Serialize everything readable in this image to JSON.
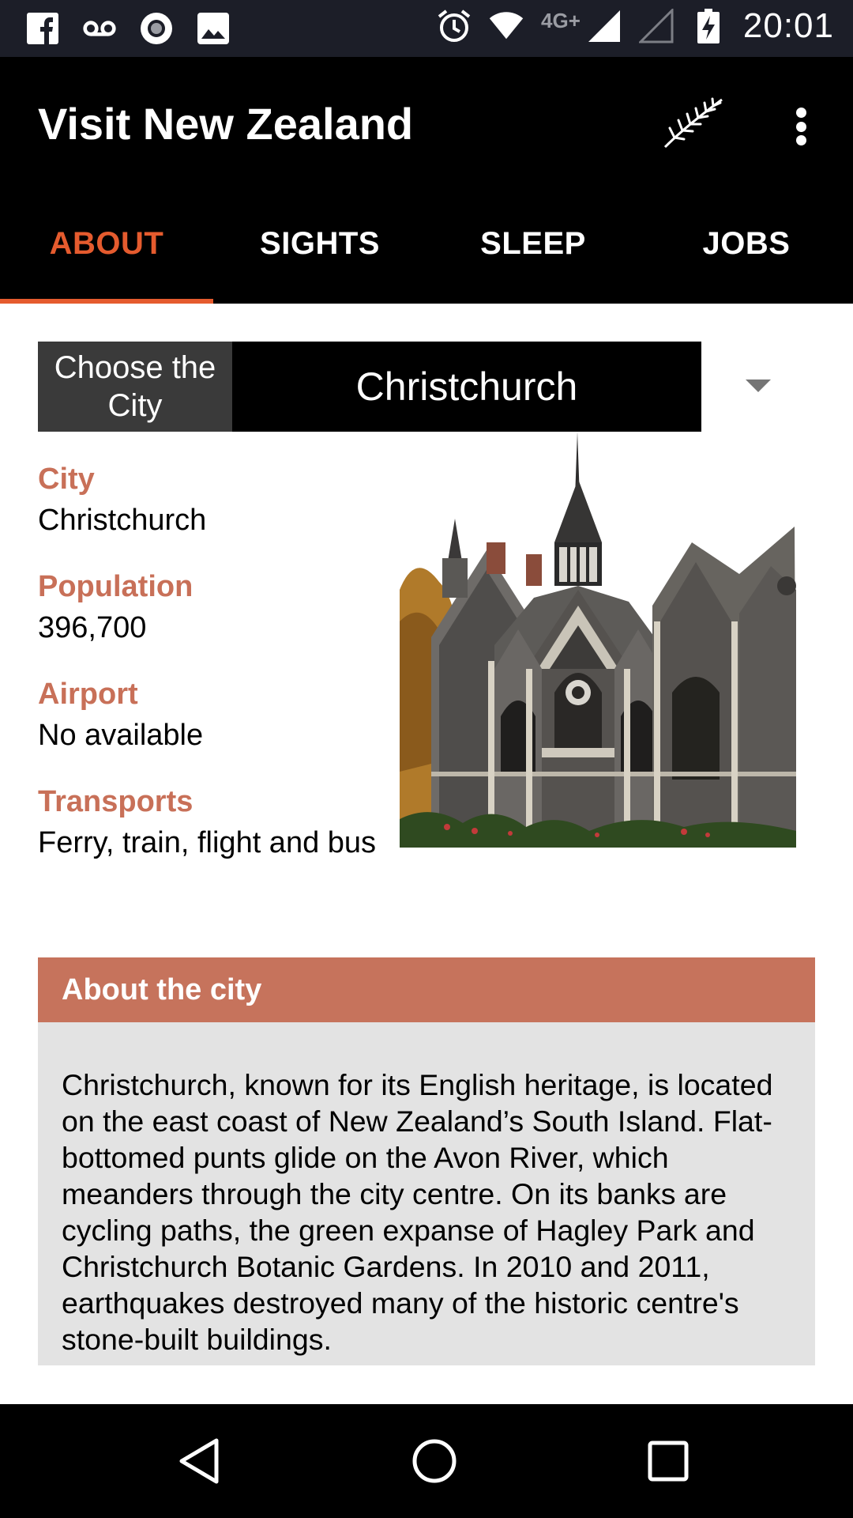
{
  "status_bar": {
    "time": "20:01",
    "network": "4G+",
    "icons": [
      "facebook-icon",
      "voicemail-icon",
      "record-icon",
      "image-icon",
      "alarm-icon",
      "wifi-icon",
      "signal-icon",
      "battery-charging-icon"
    ]
  },
  "app_bar": {
    "title": "Visit New Zealand",
    "icons": [
      "silver-fern-icon",
      "more-vert-icon"
    ]
  },
  "tabs": [
    {
      "label": "ABOUT",
      "active": true
    },
    {
      "label": "SIGHTS",
      "active": false
    },
    {
      "label": "SLEEP",
      "active": false
    },
    {
      "label": "JOBS",
      "active": false
    }
  ],
  "city_picker": {
    "label": "Choose the City",
    "selected": "Christchurch"
  },
  "info": [
    {
      "label": "City",
      "value": "Christchurch"
    },
    {
      "label": "Population",
      "value": "396,700"
    },
    {
      "label": "Airport",
      "value": "No available"
    },
    {
      "label": "Transports",
      "value": "Ferry, train, flight and bus"
    }
  ],
  "about": {
    "title": "About the city",
    "text": "Christchurch, known for its English heritage, is located on the east coast of New Zealand’s South Island. Flat-bottomed punts glide on the Avon River, which meanders through the city centre. On its banks are cycling paths, the green expanse of Hagley Park and Christchurch Botanic Gardens. In 2010 and 2011, earthquakes destroyed many of the historic centre's stone-built buildings."
  },
  "nav_bar": {
    "icons": [
      "back-icon",
      "home-icon",
      "recents-icon"
    ]
  },
  "colors": {
    "accent": "#e55b2e",
    "label": "#c87058",
    "card_header": "#c6735c",
    "card_body": "#e3e3e3"
  }
}
